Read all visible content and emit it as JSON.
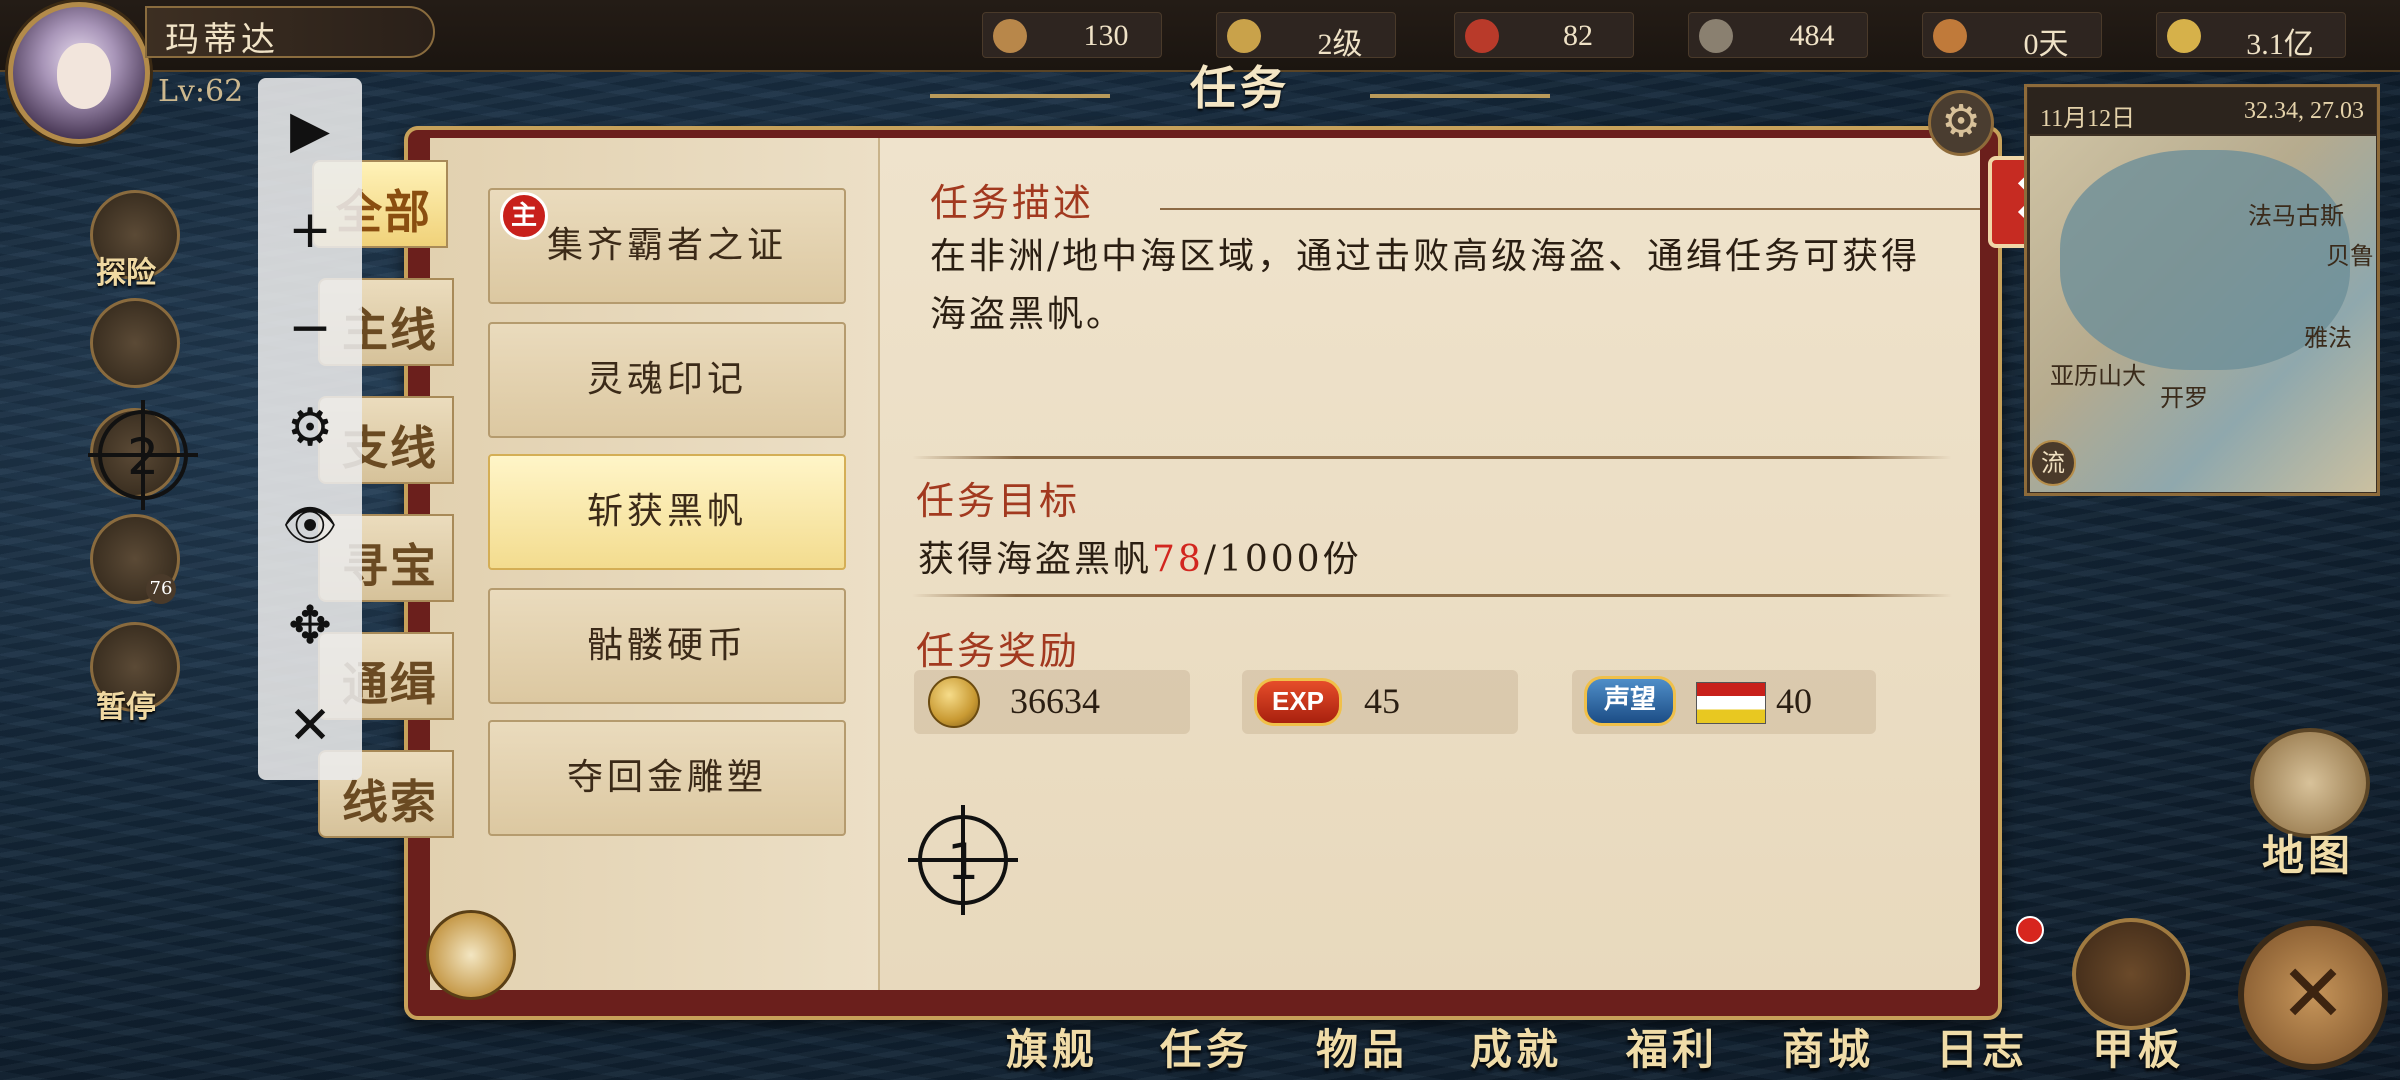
{
  "player": {
    "name": "玛蒂达",
    "level": "Lv:62"
  },
  "resources": [
    {
      "icon": "rope-icon",
      "value": "130"
    },
    {
      "icon": "rank-icon",
      "value": "2级"
    },
    {
      "icon": "crew-icon",
      "value": "82"
    },
    {
      "icon": "sailor-icon",
      "value": "484"
    },
    {
      "icon": "bread-icon",
      "value": "0天"
    },
    {
      "icon": "gold-coin-icon",
      "value": "3.1亿"
    }
  ],
  "window": {
    "title": "任务"
  },
  "filters": [
    "全部",
    "主线",
    "支线",
    "寻宝",
    "通缉",
    "线索"
  ],
  "quests": [
    {
      "label": "集齐霸者之证",
      "badge": "主"
    },
    {
      "label": "灵魂印记"
    },
    {
      "label": "斩获黑帆"
    },
    {
      "label": "骷髅硬币"
    },
    {
      "label": "夺回金雕塑"
    }
  ],
  "detail": {
    "desc_heading": "任务描述",
    "description": "在非洲/地中海区域，通过击败高级海盗、通缉任务可获得海盗黑帆。",
    "goal_heading": "任务目标",
    "goal_prefix": "获得海盗黑帆",
    "goal_current": "78",
    "goal_suffix": "/1000份",
    "reward_heading": "任务奖励",
    "rewards": [
      {
        "icon": "gold-coin-icon",
        "value": "36634"
      },
      {
        "icon": "exp-icon",
        "badge": "EXP",
        "value": "45"
      },
      {
        "icon": "reputation-icon",
        "badge": "声望",
        "value": "40"
      }
    ]
  },
  "minimap": {
    "date": "11月12日",
    "coords": "32.34, 27.03",
    "cities": [
      "法马古斯",
      "贝鲁",
      "雅法",
      "亚历山大",
      "开罗"
    ],
    "stream_label": "流"
  },
  "side_buttons": [
    {
      "icon": "explore-icon",
      "label": "探险"
    },
    {
      "icon": "anchor-icon",
      "label": ""
    },
    {
      "icon": "target-icon",
      "label": ""
    },
    {
      "icon": "hourglass-icon",
      "label": "",
      "count": "76"
    },
    {
      "icon": "pause-icon",
      "label": "暂停"
    }
  ],
  "toolbar": [
    "▶",
    "+",
    "−",
    "⚙",
    "👁",
    "✥",
    "✕"
  ],
  "markers": [
    "1",
    "2"
  ],
  "bottom_nav": [
    "旗舰",
    "任务",
    "物品",
    "成就",
    "福利",
    "商城",
    "日志",
    "甲板"
  ],
  "map_button": "地图",
  "colors": {
    "accent_red": "#c62b22",
    "goal_highlight": "#d2261f",
    "gold": "#c7a15a"
  }
}
